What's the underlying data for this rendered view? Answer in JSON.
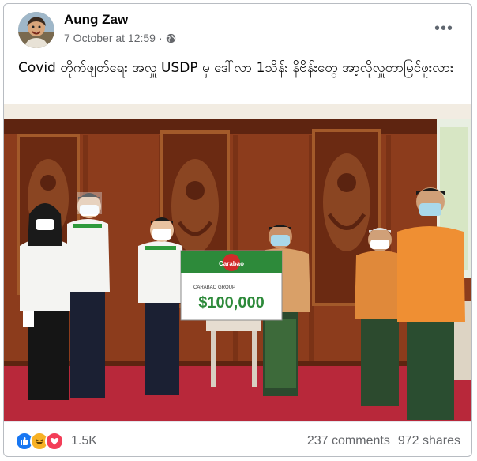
{
  "post": {
    "author": "Aung Zaw",
    "timestamp": "7 October at 12:59",
    "dot": "·",
    "privacy_icon": "globe-icon",
    "more_icon": "more-horizontal-icon",
    "more_label": "•••",
    "caption": "Covid တိုက်ဖျတ်ရေး အလှူ USDP မှ ဒေါ်လာ 1သိန်း နိဗိန်းတွေ အာ့လိုလှူတာမြင်ဖူးလား"
  },
  "photo": {
    "check_brand": "Carabao",
    "check_company_line": "CARABAO GROUP",
    "check_amount": "$100,000"
  },
  "footer": {
    "reaction_icons": [
      "like-icon",
      "haha-icon",
      "love-icon"
    ],
    "reaction_count": "1.5K",
    "comments": "237 comments",
    "shares": "972 shares"
  },
  "colors": {
    "like": "#1877f2",
    "haha": "#f7b125",
    "love": "#f33e58",
    "text_secondary": "#65676b"
  }
}
